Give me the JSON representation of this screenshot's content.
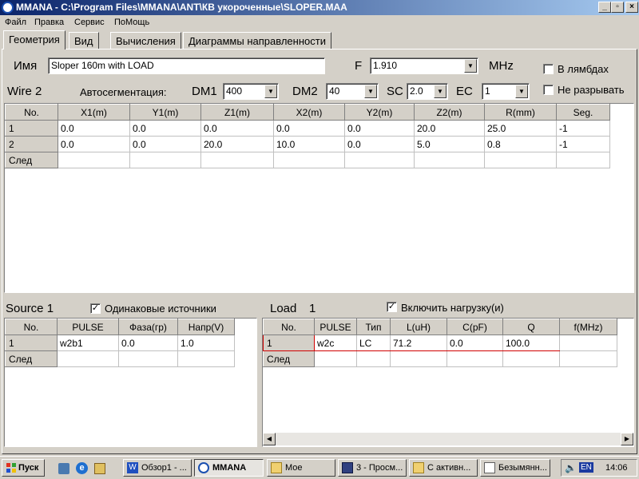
{
  "window": {
    "title": "MMANA - C:\\Program Files\\MMANA\\ANT\\КВ укороченные\\SLOPER.MAA",
    "minimize": "_",
    "maximize": "▫",
    "close": "×"
  },
  "menu": [
    "Файл",
    "Правка",
    "Сервис",
    "ПоМощь"
  ],
  "tabs": [
    "Геометрия",
    "Вид",
    "Вычисления",
    "Диаграммы направленности"
  ],
  "geometry": {
    "name_label": "Имя",
    "name_value": "Sloper 160m with LOAD",
    "f_label": "F",
    "f_value": "1.910",
    "f_unit": "MHz",
    "in_lambdas_label": "В лямбдах",
    "no_break_label": "Не разрывать",
    "wire_label": "Wire 2",
    "autoseg_label": "Автосегментация:",
    "dm1_label": "DM1",
    "dm1_value": "400",
    "dm2_label": "DM2",
    "dm2_value": "40",
    "sc_label": "SC",
    "sc_value": "2.0",
    "ec_label": "EC",
    "ec_value": "1"
  },
  "wires": {
    "headers": [
      "No.",
      "X1(m)",
      "Y1(m)",
      "Z1(m)",
      "X2(m)",
      "Y2(m)",
      "Z2(m)",
      "R(mm)",
      "Seg."
    ],
    "rows": [
      [
        "1",
        "0.0",
        "0.0",
        "0.0",
        "0.0",
        "0.0",
        "20.0",
        "25.0",
        "-1"
      ],
      [
        "2",
        "0.0",
        "0.0",
        "20.0",
        "10.0",
        "0.0",
        "5.0",
        "0.8",
        "-1"
      ]
    ],
    "next_label": "След"
  },
  "source": {
    "title": "Source 1",
    "same_sources_label": "Одинаковые источники",
    "headers": [
      "No.",
      "PULSE",
      "Фаза(гр)",
      "Напр(V)"
    ],
    "rows": [
      [
        "1",
        "w2b1",
        "0.0",
        "1.0"
      ]
    ],
    "next_label": "След"
  },
  "load": {
    "title": "Load",
    "title_num": "1",
    "enable_label": "Включить нагрузку(и)",
    "headers": [
      "No.",
      "PULSE",
      "Тип",
      "L(uH)",
      "C(pF)",
      "Q",
      "f(MHz)"
    ],
    "rows": [
      [
        "1",
        "w2c",
        "LC",
        "71.2",
        "0.0",
        "100.0",
        ""
      ]
    ],
    "next_label": "След"
  },
  "taskbar": {
    "start": "Пуск",
    "items": [
      "Обзор1 - ...",
      "MMANA",
      "Мое",
      "3 - Просм...",
      "С активн...",
      "Безымянн..."
    ],
    "lang": "EN",
    "clock": "14:06"
  }
}
